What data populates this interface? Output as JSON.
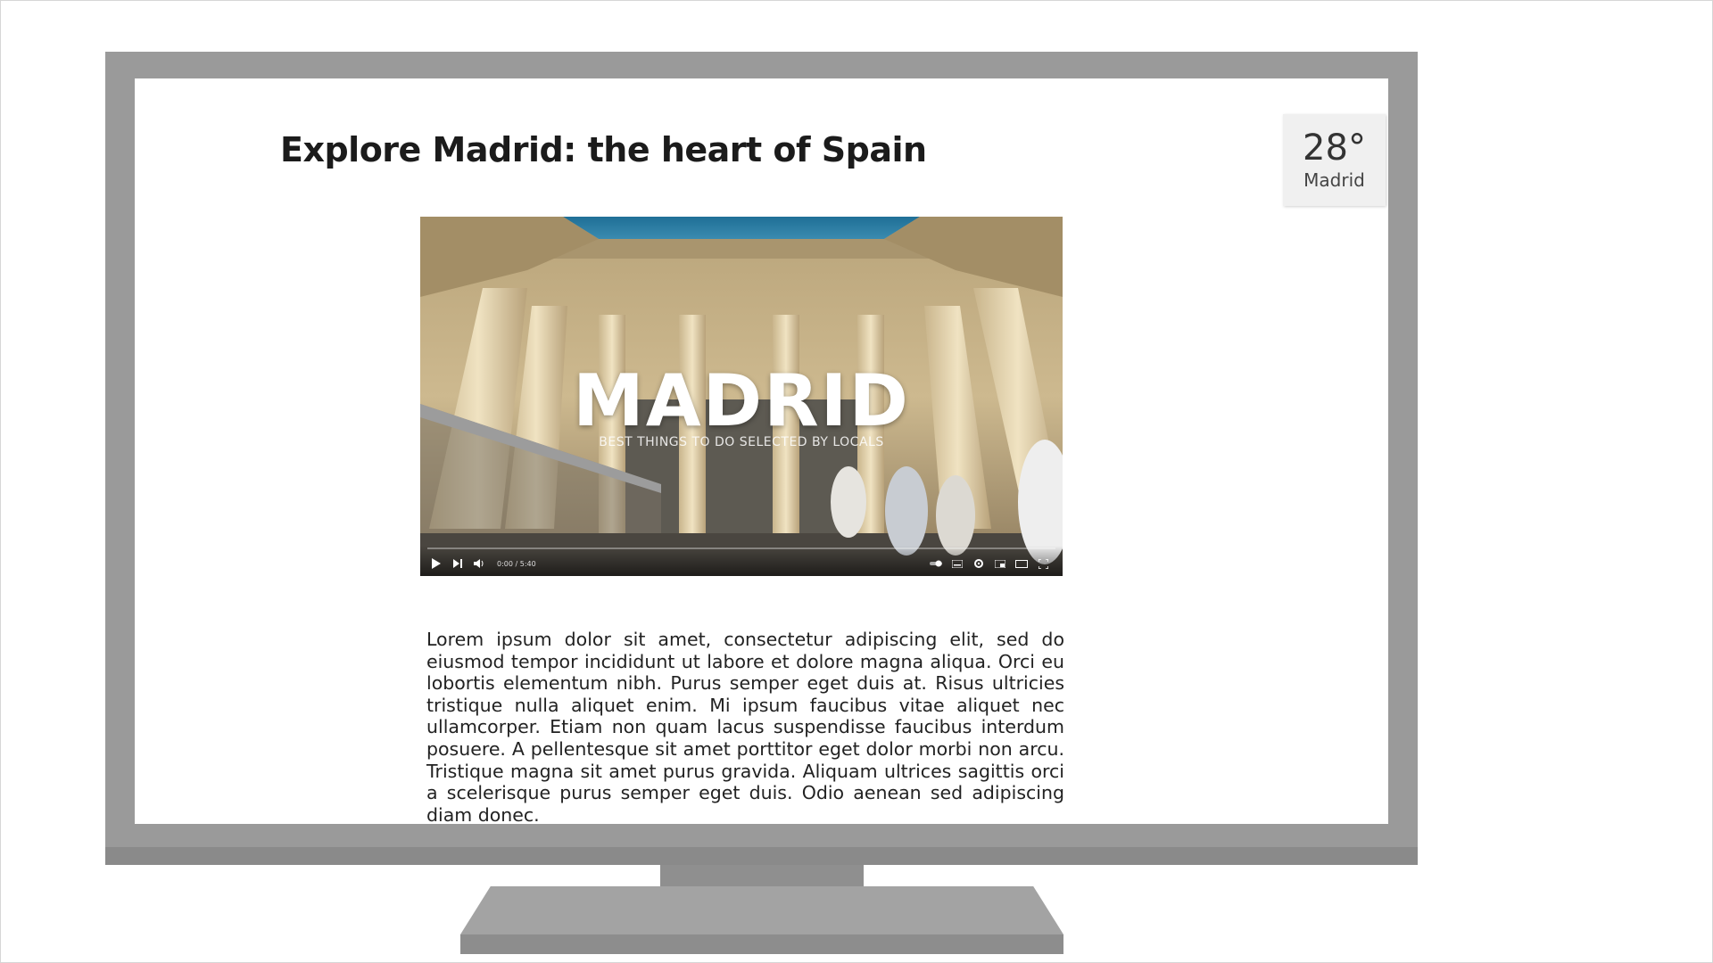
{
  "page": {
    "title": "Explore Madrid:  the heart of Spain"
  },
  "weather": {
    "temperature": "28°",
    "city": "Madrid"
  },
  "video": {
    "title": "MADRID",
    "subtitle": "BEST THINGS TO DO SELECTED BY LOCALS",
    "time": "0:00 / 5:40",
    "progress": 0,
    "icons": {
      "play": "play-icon",
      "next": "skip-next-icon",
      "volume": "volume-icon",
      "settings": "gear-icon",
      "subtitles": "subtitles-icon",
      "miniplayer": "miniplayer-icon",
      "theater": "theater-mode-icon",
      "fullscreen": "fullscreen-icon"
    }
  },
  "article": {
    "body": "Lorem ipsum dolor sit amet, consectetur adipiscing elit, sed do eiusmod tempor incididunt ut labore et dolore magna aliqua. Orci eu lobortis elementum nibh. Purus semper eget duis at. Risus ultricies tristique nulla aliquet enim. Mi ipsum faucibus vitae aliquet nec ullamcorper. Etiam non quam lacus suspendisse faucibus interdum posuere. A pellentesque sit amet porttitor eget dolor morbi non arcu. Tristique magna sit amet purus gravida. Aliquam ultrices sagittis orci a scelerisque purus semper eget duis. Odio aenean sed adipiscing diam donec."
  },
  "colors": {
    "monitor": "#9a9a9a",
    "screen": "#ffffff",
    "widget": "#f0f0f0"
  }
}
